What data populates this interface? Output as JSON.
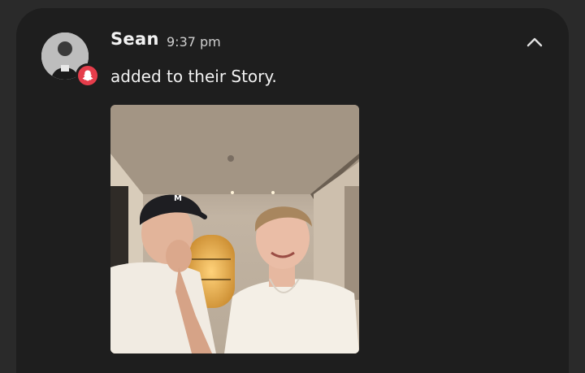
{
  "notification": {
    "sender": "Sean",
    "time": "9:37 pm",
    "message": "added to their Story.",
    "app_badge_icon": "snapchat-ghost-icon",
    "collapse_icon": "chevron-up-icon",
    "colors": {
      "background": "#2a2a2a",
      "card": "#1e1e1e",
      "badge": "#e53d4b",
      "text": "#f2f2f2"
    }
  }
}
